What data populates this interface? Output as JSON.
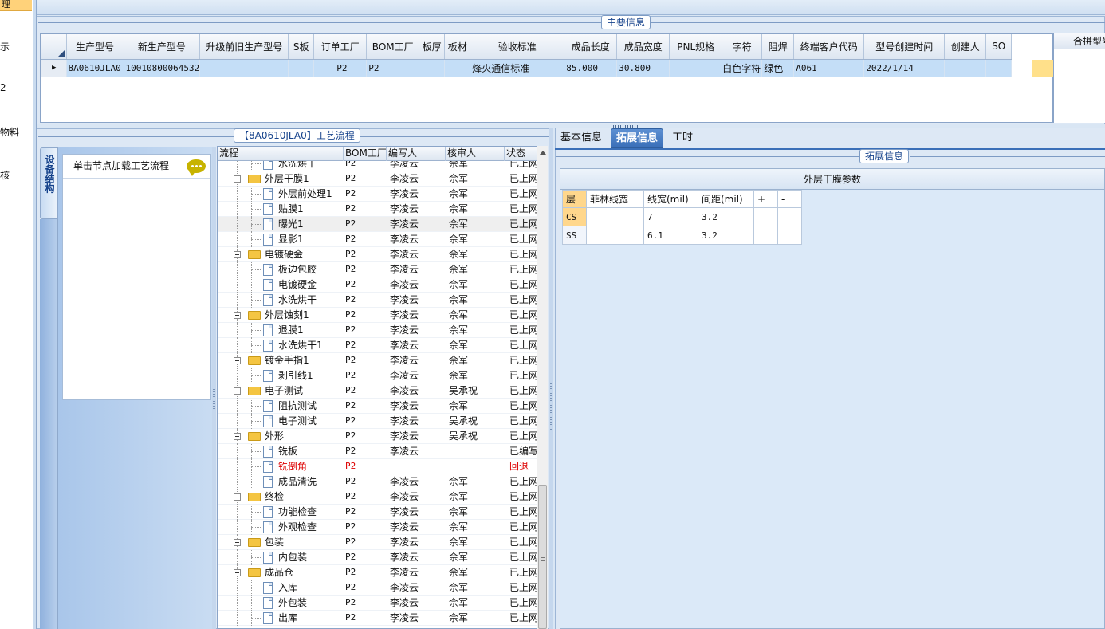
{
  "nav": {
    "selected": "理",
    "items": [
      "示",
      "2",
      "物料",
      "核"
    ]
  },
  "main_panel": {
    "title": "主要信息",
    "columns": [
      "生产型号",
      "新生产型号",
      "升级前旧生产型号",
      "S板",
      "订单工厂",
      "BOM工厂",
      "板厚",
      "板材",
      "验收标准",
      "成品长度",
      "成品宽度",
      "PNL规格",
      "字符",
      "阻焊",
      "终端客户代码",
      "型号创建时间",
      "创建人",
      "SO"
    ],
    "row": [
      "8A0610JLA0",
      "10010800064532",
      "",
      "",
      "P2",
      "P2",
      "",
      "",
      "烽火通信标准",
      "85.000",
      "30.800",
      "",
      "白色字符",
      "绿色",
      "A061",
      "2022/1/14",
      "",
      ""
    ],
    "merged_header": "合拼型号"
  },
  "process_panel": {
    "title": "【8A0610JLA0】工艺流程",
    "vertical_tab": "设备结构",
    "node_hint": "单击节点加载工艺流程",
    "columns": [
      "流程",
      "BOM工厂",
      "编写人",
      "核审人",
      "状态"
    ],
    "rows": [
      {
        "level": 2,
        "name": "水洗烘干",
        "bom": "P2",
        "writer": "李凌云",
        "reviewer": "佘军",
        "status": "已上网"
      },
      {
        "level": 1,
        "name": "外层干膜1",
        "bom": "P2",
        "writer": "李凌云",
        "reviewer": "佘军",
        "status": "已上网"
      },
      {
        "level": 2,
        "name": "外层前处理1",
        "bom": "P2",
        "writer": "李凌云",
        "reviewer": "佘军",
        "status": "已上网"
      },
      {
        "level": 2,
        "name": "贴膜1",
        "bom": "P2",
        "writer": "李凌云",
        "reviewer": "佘军",
        "status": "已上网"
      },
      {
        "level": 2,
        "name": "曝光1",
        "bom": "P2",
        "writer": "李凌云",
        "reviewer": "佘军",
        "status": "已上网",
        "highlight": true
      },
      {
        "level": 2,
        "name": "显影1",
        "bom": "P2",
        "writer": "李凌云",
        "reviewer": "佘军",
        "status": "已上网"
      },
      {
        "level": 1,
        "name": "电镀硬金",
        "bom": "P2",
        "writer": "李凌云",
        "reviewer": "佘军",
        "status": "已上网"
      },
      {
        "level": 2,
        "name": "板边包胶",
        "bom": "P2",
        "writer": "李凌云",
        "reviewer": "佘军",
        "status": "已上网"
      },
      {
        "level": 2,
        "name": "电镀硬金",
        "bom": "P2",
        "writer": "李凌云",
        "reviewer": "佘军",
        "status": "已上网"
      },
      {
        "level": 2,
        "name": "水洗烘干",
        "bom": "P2",
        "writer": "李凌云",
        "reviewer": "佘军",
        "status": "已上网"
      },
      {
        "level": 1,
        "name": "外层蚀刻1",
        "bom": "P2",
        "writer": "李凌云",
        "reviewer": "佘军",
        "status": "已上网"
      },
      {
        "level": 2,
        "name": "退膜1",
        "bom": "P2",
        "writer": "李凌云",
        "reviewer": "佘军",
        "status": "已上网"
      },
      {
        "level": 2,
        "name": "水洗烘干1",
        "bom": "P2",
        "writer": "李凌云",
        "reviewer": "佘军",
        "status": "已上网"
      },
      {
        "level": 1,
        "name": "镀金手指1",
        "bom": "P2",
        "writer": "李凌云",
        "reviewer": "佘军",
        "status": "已上网"
      },
      {
        "level": 2,
        "name": "剥引线1",
        "bom": "P2",
        "writer": "李凌云",
        "reviewer": "佘军",
        "status": "已上网"
      },
      {
        "level": 1,
        "name": "电子测试",
        "bom": "P2",
        "writer": "李凌云",
        "reviewer": "吴承祝",
        "status": "已上网"
      },
      {
        "level": 2,
        "name": "阻抗测试",
        "bom": "P2",
        "writer": "李凌云",
        "reviewer": "佘军",
        "status": "已上网"
      },
      {
        "level": 2,
        "name": "电子测试",
        "bom": "P2",
        "writer": "李凌云",
        "reviewer": "吴承祝",
        "status": "已上网"
      },
      {
        "level": 1,
        "name": "外形",
        "bom": "P2",
        "writer": "李凌云",
        "reviewer": "吴承祝",
        "status": "已上网"
      },
      {
        "level": 2,
        "name": "铣板",
        "bom": "P2",
        "writer": "李凌云",
        "reviewer": "",
        "status": "已编写"
      },
      {
        "level": 2,
        "name": "铣倒角",
        "bom": "P2",
        "writer": "",
        "reviewer": "",
        "status": "回退",
        "red": true
      },
      {
        "level": 2,
        "name": "成品清洗",
        "bom": "P2",
        "writer": "李凌云",
        "reviewer": "佘军",
        "status": "已上网"
      },
      {
        "level": 1,
        "name": "终检",
        "bom": "P2",
        "writer": "李凌云",
        "reviewer": "佘军",
        "status": "已上网"
      },
      {
        "level": 2,
        "name": "功能检查",
        "bom": "P2",
        "writer": "李凌云",
        "reviewer": "佘军",
        "status": "已上网"
      },
      {
        "level": 2,
        "name": "外观检查",
        "bom": "P2",
        "writer": "李凌云",
        "reviewer": "佘军",
        "status": "已上网"
      },
      {
        "level": 1,
        "name": "包装",
        "bom": "P2",
        "writer": "李凌云",
        "reviewer": "佘军",
        "status": "已上网"
      },
      {
        "level": 2,
        "name": "内包装",
        "bom": "P2",
        "writer": "李凌云",
        "reviewer": "佘军",
        "status": "已上网"
      },
      {
        "level": 1,
        "name": "成品仓",
        "bom": "P2",
        "writer": "李凌云",
        "reviewer": "佘军",
        "status": "已上网"
      },
      {
        "level": 2,
        "name": "入库",
        "bom": "P2",
        "writer": "李凌云",
        "reviewer": "佘军",
        "status": "已上网"
      },
      {
        "level": 2,
        "name": "外包装",
        "bom": "P2",
        "writer": "李凌云",
        "reviewer": "佘军",
        "status": "已上网"
      },
      {
        "level": 2,
        "name": "出库",
        "bom": "P2",
        "writer": "李凌云",
        "reviewer": "佘军",
        "status": "已上网"
      }
    ]
  },
  "right_panel": {
    "tabs": [
      "基本信息",
      "拓展信息",
      "工时"
    ],
    "active_tab": "拓展信息",
    "group_title": "拓展信息",
    "table_title": "外层干膜参数",
    "param_columns": [
      "层",
      "菲林线宽",
      "线宽(mil)",
      "间距(mil)",
      "+",
      "-"
    ],
    "param_rows": [
      {
        "layer": "CS",
        "film": "",
        "width": "7",
        "spacing": "3.2"
      },
      {
        "layer": "SS",
        "film": "",
        "width": "6.1",
        "spacing": "3.2"
      }
    ]
  },
  "colors": {
    "selection_row": "#c4def7",
    "active_tab": "#3a6fb8",
    "panel_bg": "#dde8f5",
    "highlight_cell": "#ffd78c",
    "error_text": "#dd0000"
  }
}
